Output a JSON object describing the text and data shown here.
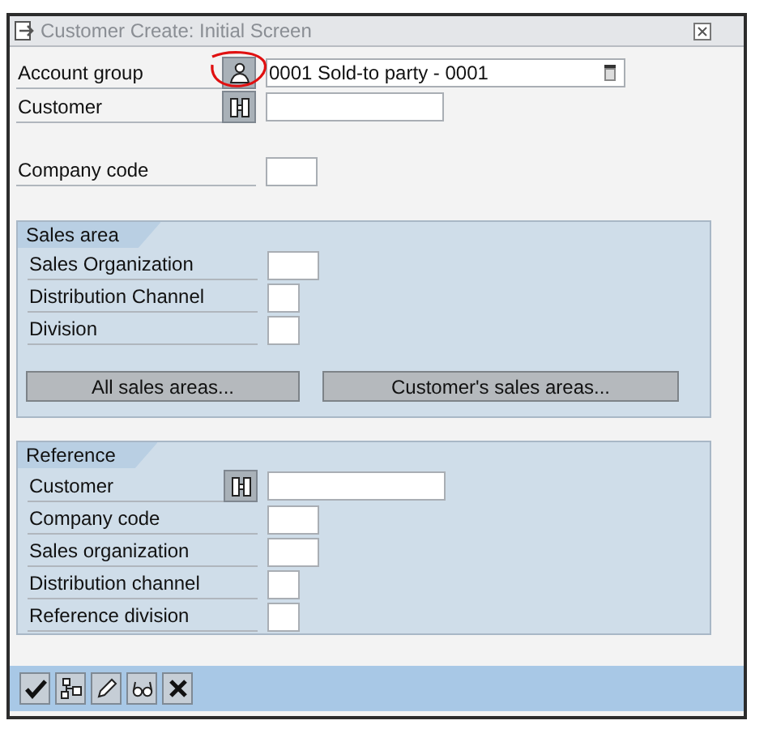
{
  "window": {
    "title": "Customer Create: Initial Screen"
  },
  "header_fields": [
    {
      "label": "Account group",
      "help_button": {
        "kind": "person"
      },
      "kind": "dropdown",
      "value": "0001 Sold-to party - 0001",
      "circled": true
    },
    {
      "label": "Customer",
      "help_button": {
        "kind": "search"
      },
      "kind": "long",
      "circled": false
    }
  ],
  "company_code": {
    "label": "Company code",
    "kind": "medium"
  },
  "sales_area": {
    "title": "Sales area",
    "fields": [
      {
        "label": "Sales Organization",
        "kind": "medium"
      },
      {
        "label": "Distribution Channel",
        "kind": "short"
      },
      {
        "label": "Division",
        "kind": "short"
      }
    ],
    "buttons": [
      "All sales areas...",
      "Customer's sales areas..."
    ]
  },
  "reference": {
    "title": "Reference",
    "fields": [
      {
        "label": "Customer",
        "help_button": {
          "kind": "search"
        },
        "kind": "long"
      },
      {
        "label": "Company code",
        "kind": "medium"
      },
      {
        "label": "Sales organization",
        "kind": "medium"
      },
      {
        "label": "Distribution channel",
        "kind": "short"
      },
      {
        "label": "Reference division",
        "kind": "short"
      }
    ]
  },
  "toolbar": [
    {
      "kind": "confirm"
    },
    {
      "kind": "hierarchy"
    },
    {
      "kind": "edit"
    },
    {
      "kind": "display"
    },
    {
      "kind": "cancel"
    }
  ]
}
